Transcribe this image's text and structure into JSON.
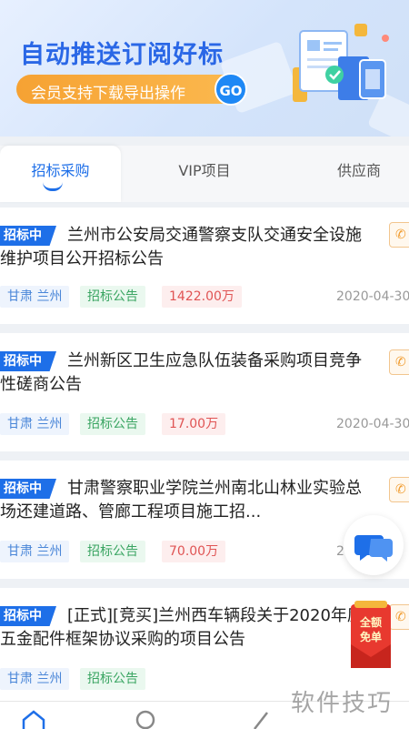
{
  "banner": {
    "title": "自动推送订阅好标",
    "subtitle": "会员支持下载导出操作",
    "go_label": "GO"
  },
  "tabs": [
    {
      "label": "招标采购",
      "active": true
    },
    {
      "label": "VIP项目",
      "active": false
    },
    {
      "label": "供应商",
      "active": false
    }
  ],
  "listings": [
    {
      "badge": "招标中",
      "title": "兰州市公安局交通警察支队交通安全设施维护项目公开招标公告",
      "region": "甘肃 兰州",
      "type": "招标公告",
      "amount": "1422.00万",
      "date": "2020-04-30"
    },
    {
      "badge": "招标中",
      "title": "兰州新区卫生应急队伍装备采购项目竞争性磋商公告",
      "region": "甘肃 兰州",
      "type": "招标公告",
      "amount": "17.00万",
      "date": "2020-04-30"
    },
    {
      "badge": "招标中",
      "title": "甘肃警察职业学院兰州南北山林业实验总场还建道路、管廊工程项目施工招...",
      "region": "甘肃 兰州",
      "type": "招标公告",
      "amount": "70.00万",
      "date": "2"
    },
    {
      "badge": "招标中",
      "title": "[正式][竞买]兰州西车辆段关于2020年度五金配件框架协议采购的项目公告",
      "region": "甘肃 兰州",
      "type": "招标公告",
      "amount": "",
      "date": ""
    }
  ],
  "coupon": {
    "line1": "全额",
    "line2": "免单"
  },
  "watermark": "软件技巧",
  "colors": {
    "accent": "#1e6fe8",
    "orange": "#f6a233",
    "red": "#e05454",
    "green": "#3aa562"
  }
}
